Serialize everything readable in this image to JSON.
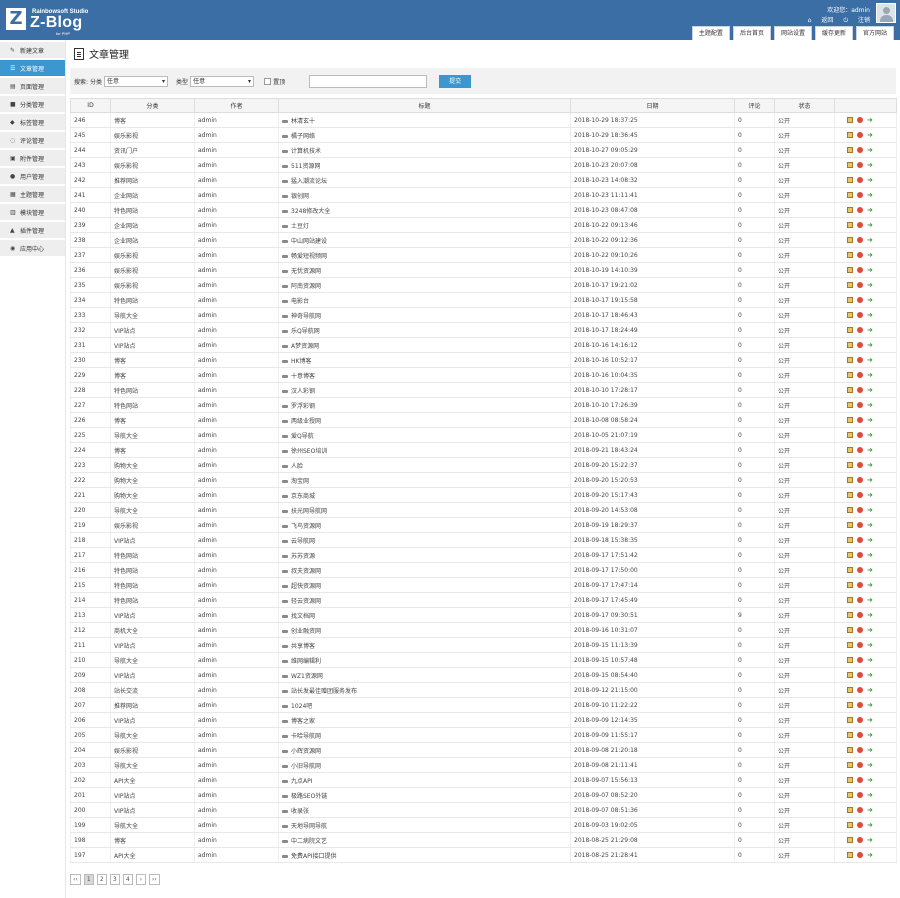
{
  "header": {
    "logo_letter": "Z",
    "logo_company": "Rainbowsoft Studio",
    "logo_text": "Z-Blog",
    "logo_sub": "for PHP",
    "user_welcome": "欢迎您：admin",
    "home_link": "返回",
    "logout_link": "注销"
  },
  "topnav": [
    "主题配置",
    "后台首页",
    "网站设置",
    "缓存更新",
    "官方网站"
  ],
  "sidebar": [
    {
      "label": "新建文章",
      "icon": "✎"
    },
    {
      "label": "文章管理",
      "icon": "☰",
      "active": true
    },
    {
      "label": "页面管理",
      "icon": "▤"
    },
    {
      "label": "分类管理",
      "icon": "■"
    },
    {
      "label": "标签管理",
      "icon": "◆"
    },
    {
      "label": "评论管理",
      "icon": "◌"
    },
    {
      "label": "附件管理",
      "icon": "▣"
    },
    {
      "label": "用户管理",
      "icon": "●"
    },
    {
      "label": "主题管理",
      "icon": "▦"
    },
    {
      "label": "模块管理",
      "icon": "▥"
    },
    {
      "label": "插件管理",
      "icon": "▲"
    },
    {
      "label": "应用中心",
      "icon": "◉"
    }
  ],
  "page_title": "文章管理",
  "filter": {
    "search_label": "搜索:",
    "category_label": "分类",
    "category_value": "任意",
    "type_label": "类型",
    "type_value": "任意",
    "top_label": "置顶",
    "submit_label": "提交"
  },
  "table": {
    "headers": [
      "ID",
      "分类",
      "作者",
      "标题",
      "日期",
      "评论",
      "状态",
      ""
    ],
    "rows": [
      {
        "id": "246",
        "category": "博客",
        "author": "admin",
        "title": "林清玄十",
        "date": "2018-10-29 18:37:25",
        "comments": "0",
        "status": "公开"
      },
      {
        "id": "245",
        "category": "娱乐影视",
        "author": "admin",
        "title": "橘子网络",
        "date": "2018-10-29 18:36:45",
        "comments": "0",
        "status": "公开"
      },
      {
        "id": "244",
        "category": "资讯门户",
        "author": "admin",
        "title": "计算机技术",
        "date": "2018-10-27 09:05:29",
        "comments": "0",
        "status": "公开"
      },
      {
        "id": "243",
        "category": "娱乐影视",
        "author": "admin",
        "title": "511资源网",
        "date": "2018-10-23 20:07:08",
        "comments": "0",
        "status": "公开"
      },
      {
        "id": "242",
        "category": "推荐网站",
        "author": "admin",
        "title": "猛入潮流论坛",
        "date": "2018-10-23 14:08:32",
        "comments": "0",
        "status": "公开"
      },
      {
        "id": "241",
        "category": "企业网站",
        "author": "admin",
        "title": "银创网",
        "date": "2018-10-23 11:11:41",
        "comments": "0",
        "status": "公开"
      },
      {
        "id": "240",
        "category": "特色网站",
        "author": "admin",
        "title": "3248修改大全",
        "date": "2018-10-23 08:47:08",
        "comments": "0",
        "status": "公开"
      },
      {
        "id": "239",
        "category": "企业网站",
        "author": "admin",
        "title": "土豆灯",
        "date": "2018-10-22 09:13:46",
        "comments": "0",
        "status": "公开"
      },
      {
        "id": "238",
        "category": "企业网站",
        "author": "admin",
        "title": "中山网站建设",
        "date": "2018-10-22 09:12:36",
        "comments": "0",
        "status": "公开"
      },
      {
        "id": "237",
        "category": "娱乐影视",
        "author": "admin",
        "title": "畅爱短视频网",
        "date": "2018-10-22 09:10:26",
        "comments": "0",
        "status": "公开"
      },
      {
        "id": "236",
        "category": "娱乐影视",
        "author": "admin",
        "title": "无忧资源网",
        "date": "2018-10-19 14:10:39",
        "comments": "0",
        "status": "公开"
      },
      {
        "id": "235",
        "category": "娱乐影视",
        "author": "admin",
        "title": "阿南资源网",
        "date": "2018-10-17 19:21:02",
        "comments": "0",
        "status": "公开"
      },
      {
        "id": "234",
        "category": "特色网站",
        "author": "admin",
        "title": "电影台",
        "date": "2018-10-17 19:15:58",
        "comments": "0",
        "status": "公开"
      },
      {
        "id": "233",
        "category": "导航大全",
        "author": "admin",
        "title": "神奇导航网",
        "date": "2018-10-17 18:46:43",
        "comments": "0",
        "status": "公开"
      },
      {
        "id": "232",
        "category": "VIP站点",
        "author": "admin",
        "title": "乐Q导航网",
        "date": "2018-10-17 18:24:49",
        "comments": "0",
        "status": "公开"
      },
      {
        "id": "231",
        "category": "VIP站点",
        "author": "admin",
        "title": "A梦资源网",
        "date": "2018-10-16 14:16:12",
        "comments": "0",
        "status": "公开"
      },
      {
        "id": "230",
        "category": "博客",
        "author": "admin",
        "title": "HK博客",
        "date": "2018-10-16 10:52:17",
        "comments": "0",
        "status": "公开"
      },
      {
        "id": "229",
        "category": "博客",
        "author": "admin",
        "title": "十意博客",
        "date": "2018-10-16 10:04:35",
        "comments": "0",
        "status": "公开"
      },
      {
        "id": "228",
        "category": "特色网站",
        "author": "admin",
        "title": "汉人彩钢",
        "date": "2018-10-10 17:28:17",
        "comments": "0",
        "status": "公开"
      },
      {
        "id": "227",
        "category": "特色网站",
        "author": "admin",
        "title": "罗浮彩钢",
        "date": "2018-10-10 17:26:39",
        "comments": "0",
        "status": "公开"
      },
      {
        "id": "226",
        "category": "博客",
        "author": "admin",
        "title": "两级业授网",
        "date": "2018-10-08 08:58:24",
        "comments": "0",
        "status": "公开"
      },
      {
        "id": "225",
        "category": "导航大全",
        "author": "admin",
        "title": "爱Q导航",
        "date": "2018-10-05 21:07:19",
        "comments": "0",
        "status": "公开"
      },
      {
        "id": "224",
        "category": "博客",
        "author": "admin",
        "title": "徐州SEO培训",
        "date": "2018-09-21 18:43:24",
        "comments": "0",
        "status": "公开"
      },
      {
        "id": "223",
        "category": "购物大全",
        "author": "admin",
        "title": "人脸",
        "date": "2018-09-20 15:22:37",
        "comments": "0",
        "status": "公开"
      },
      {
        "id": "222",
        "category": "购物大全",
        "author": "admin",
        "title": "淘宝网",
        "date": "2018-09-20 15:20:53",
        "comments": "0",
        "status": "公开"
      },
      {
        "id": "221",
        "category": "购物大全",
        "author": "admin",
        "title": "京东商城",
        "date": "2018-09-20 15:17:43",
        "comments": "0",
        "status": "公开"
      },
      {
        "id": "220",
        "category": "导航大全",
        "author": "admin",
        "title": "扶光网导航网",
        "date": "2018-09-20 14:53:08",
        "comments": "0",
        "status": "公开"
      },
      {
        "id": "219",
        "category": "娱乐影视",
        "author": "admin",
        "title": "飞鸟资源网",
        "date": "2018-09-19 18:29:37",
        "comments": "0",
        "status": "公开"
      },
      {
        "id": "218",
        "category": "VIP站点",
        "author": "admin",
        "title": "云导航网",
        "date": "2018-09-18 15:38:35",
        "comments": "0",
        "status": "公开"
      },
      {
        "id": "217",
        "category": "特色网站",
        "author": "admin",
        "title": "苏苏资源",
        "date": "2018-09-17 17:51:42",
        "comments": "0",
        "status": "公开"
      },
      {
        "id": "216",
        "category": "特色网站",
        "author": "admin",
        "title": "叔夫资源网",
        "date": "2018-09-17 17:50:00",
        "comments": "0",
        "status": "公开"
      },
      {
        "id": "215",
        "category": "特色网站",
        "author": "admin",
        "title": "超快资源网",
        "date": "2018-09-17 17:47:14",
        "comments": "0",
        "status": "公开"
      },
      {
        "id": "214",
        "category": "特色网站",
        "author": "admin",
        "title": "轻云资源网",
        "date": "2018-09-17 17:45:49",
        "comments": "0",
        "status": "公开"
      },
      {
        "id": "213",
        "category": "VIP站点",
        "author": "admin",
        "title": "找文档网",
        "date": "2018-09-17 09:30:51",
        "comments": "9",
        "status": "公开"
      },
      {
        "id": "212",
        "category": "商机大全",
        "author": "admin",
        "title": "创业融资网",
        "date": "2018-09-16 10:31:07",
        "comments": "0",
        "status": "公开"
      },
      {
        "id": "211",
        "category": "VIP站点",
        "author": "admin",
        "title": "共享博客",
        "date": "2018-09-15 11:13:39",
        "comments": "0",
        "status": "公开"
      },
      {
        "id": "210",
        "category": "导航大全",
        "author": "admin",
        "title": "维网编辑利",
        "date": "2018-09-15 10:57:48",
        "comments": "0",
        "status": "公开"
      },
      {
        "id": "209",
        "category": "VIP站点",
        "author": "admin",
        "title": "WZ1资源网",
        "date": "2018-09-15 08:54:40",
        "comments": "0",
        "status": "公开"
      },
      {
        "id": "208",
        "category": "站长交流",
        "author": "admin",
        "title": "站长发最佳赠团服务发布",
        "date": "2018-09-12 21:15:00",
        "comments": "0",
        "status": "公开"
      },
      {
        "id": "207",
        "category": "推荐网站",
        "author": "admin",
        "title": "1024吧",
        "date": "2018-09-10 11:22:22",
        "comments": "0",
        "status": "公开"
      },
      {
        "id": "206",
        "category": "VIP站点",
        "author": "admin",
        "title": "博客之家",
        "date": "2018-09-09 12:14:35",
        "comments": "0",
        "status": "公开"
      },
      {
        "id": "205",
        "category": "导航大全",
        "author": "admin",
        "title": "卡哈导航网",
        "date": "2018-09-09 11:55:17",
        "comments": "0",
        "status": "公开"
      },
      {
        "id": "204",
        "category": "娱乐影视",
        "author": "admin",
        "title": "小辉资源网",
        "date": "2018-09-08 21:20:18",
        "comments": "0",
        "status": "公开"
      },
      {
        "id": "203",
        "category": "导航大全",
        "author": "admin",
        "title": "小旧导航网",
        "date": "2018-09-08 21:11:41",
        "comments": "0",
        "status": "公开"
      },
      {
        "id": "202",
        "category": "API大全",
        "author": "admin",
        "title": "九点API",
        "date": "2018-09-07 15:56:13",
        "comments": "0",
        "status": "公开"
      },
      {
        "id": "201",
        "category": "VIP站点",
        "author": "admin",
        "title": "极路SEO外链",
        "date": "2018-09-07 08:52:20",
        "comments": "0",
        "status": "公开"
      },
      {
        "id": "200",
        "category": "VIP站点",
        "author": "admin",
        "title": "收录张",
        "date": "2018-09-07 08:51:36",
        "comments": "0",
        "status": "公开"
      },
      {
        "id": "199",
        "category": "导航大全",
        "author": "admin",
        "title": "天地导网导航",
        "date": "2018-09-03 19:02:05",
        "comments": "0",
        "status": "公开"
      },
      {
        "id": "198",
        "category": "博客",
        "author": "admin",
        "title": "中二病院文艺",
        "date": "2018-08-25 21:29:08",
        "comments": "0",
        "status": "公开"
      },
      {
        "id": "197",
        "category": "API大全",
        "author": "admin",
        "title": "免费API接口提供",
        "date": "2018-08-25 21:28:41",
        "comments": "0",
        "status": "公开"
      }
    ]
  },
  "pagination": [
    "‹‹",
    "1",
    "2",
    "3",
    "4",
    "›",
    "››"
  ],
  "colors": {
    "header": "#3a6ea5",
    "accent": "#3a97cf"
  }
}
